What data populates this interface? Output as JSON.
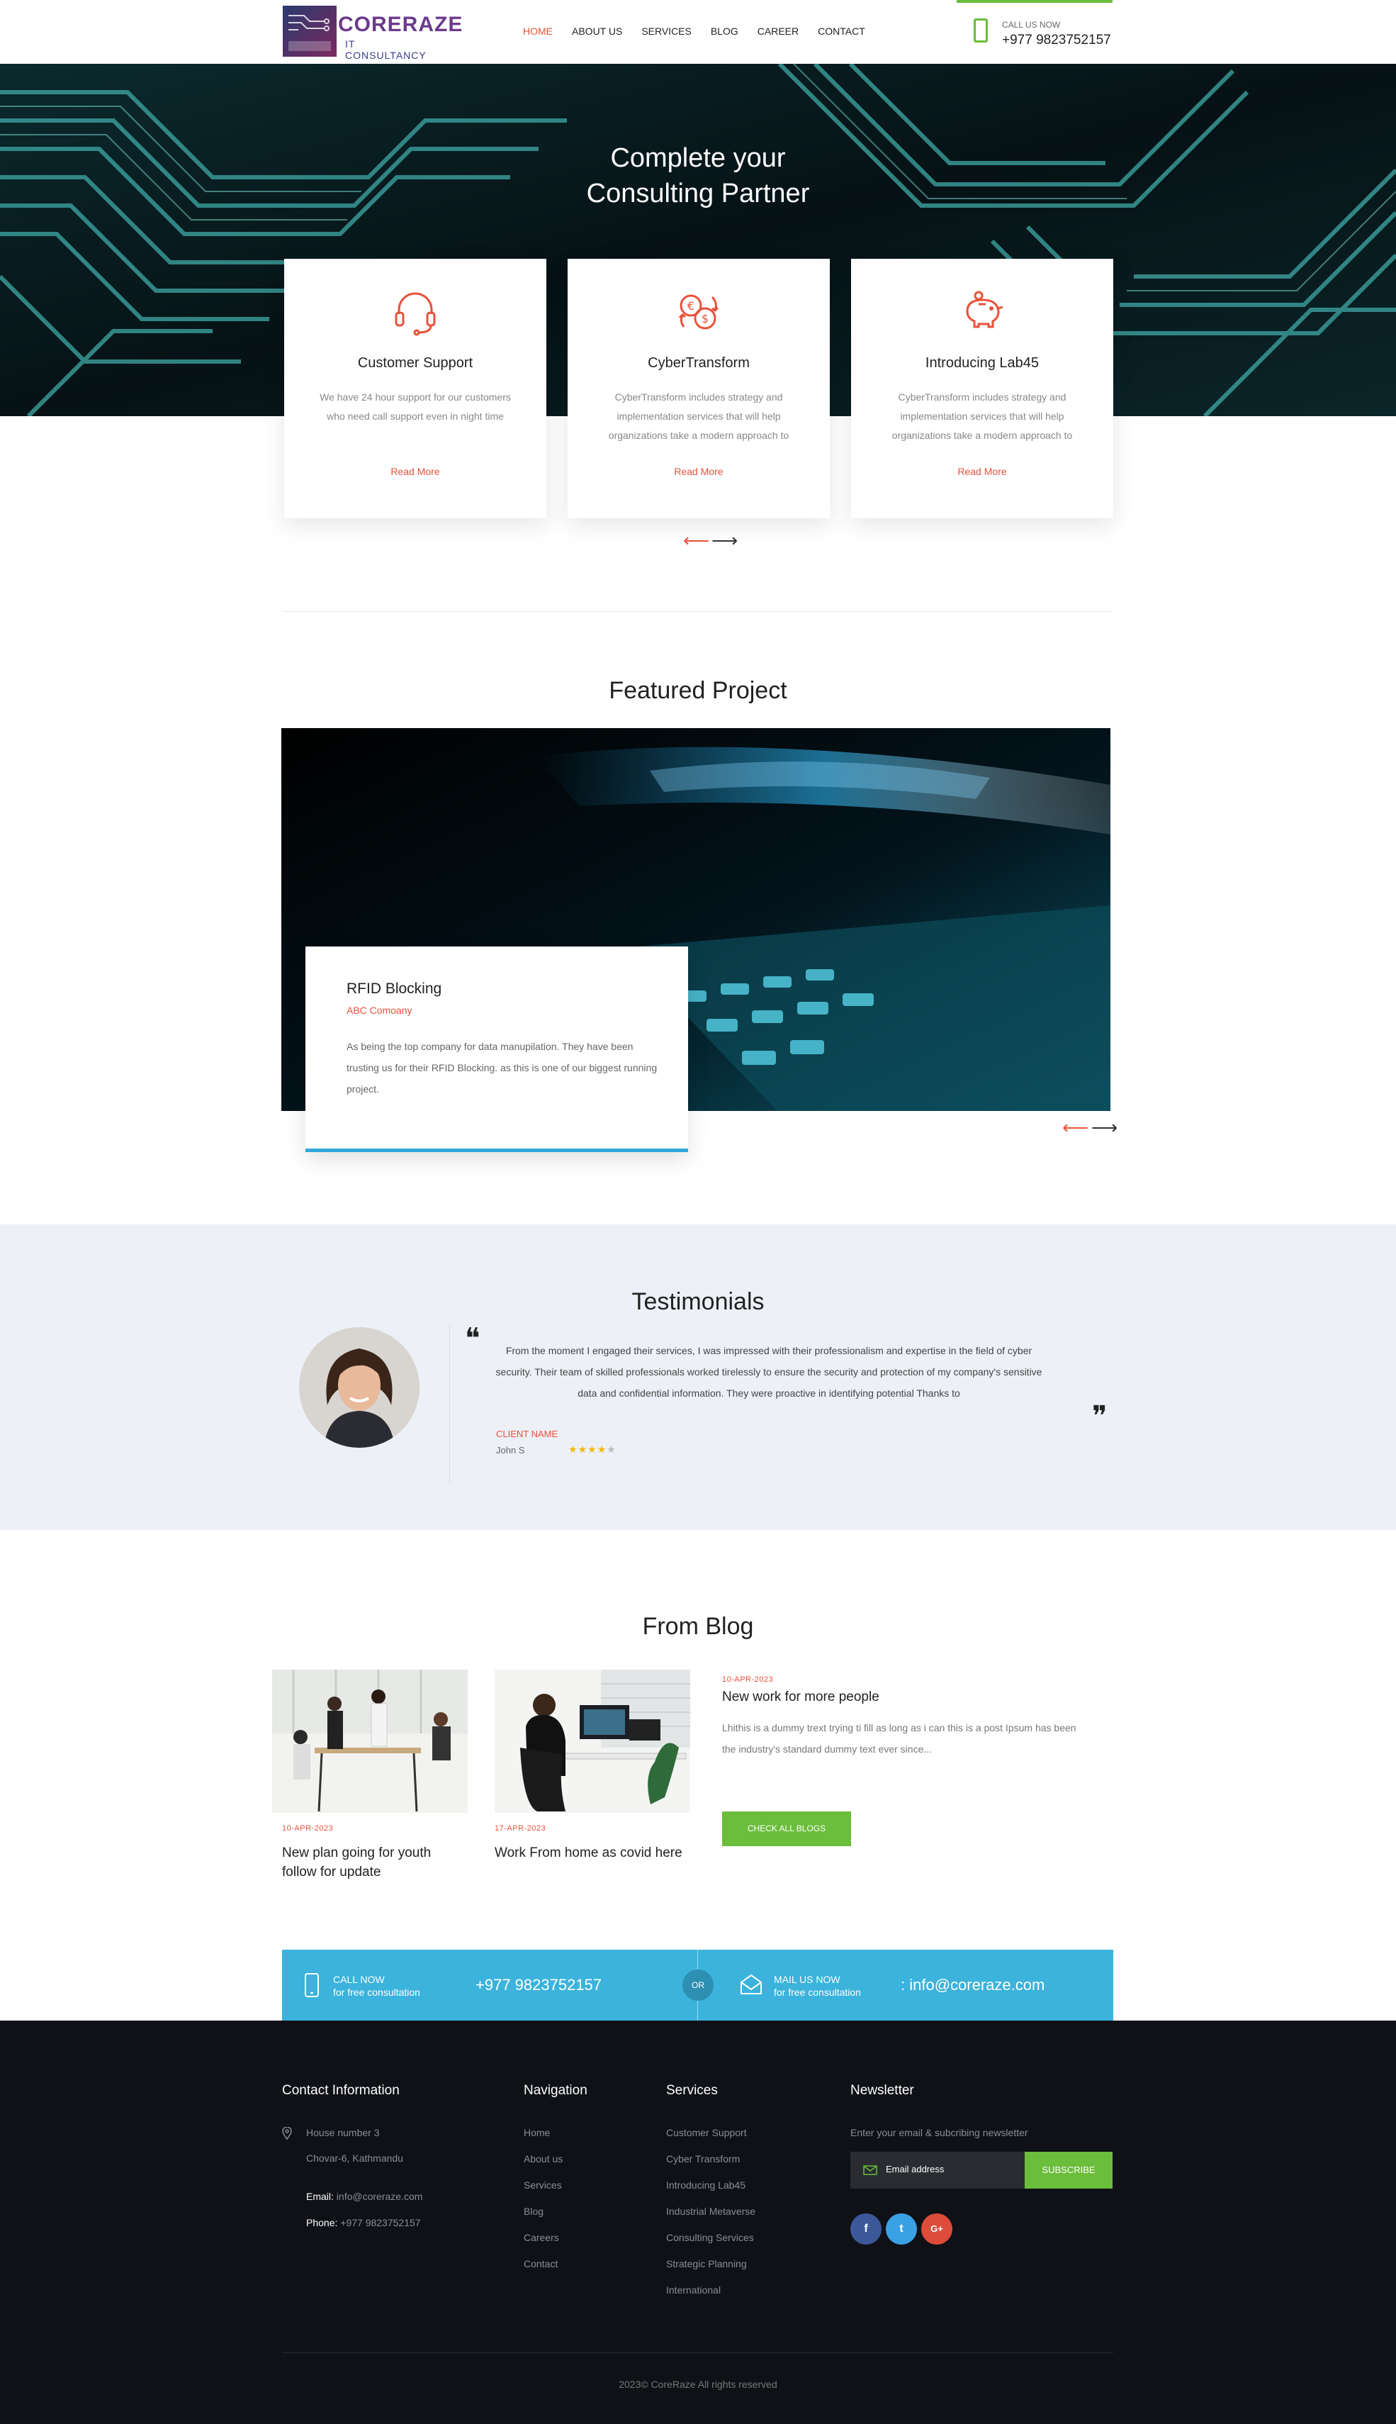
{
  "brand": {
    "logo_main": "CORERAZE",
    "logo_sub": "IT CONSULTANCY",
    "accent": "#e8523b",
    "green": "#6bbd3c",
    "blue": "#3bb3dc"
  },
  "nav": {
    "items": [
      "HOME",
      "ABOUT US",
      "SERVICES",
      "BLOG",
      "CAREER",
      "CONTACT"
    ],
    "active": "HOME"
  },
  "call": {
    "label": "CALL US NOW",
    "number": "+977 9823752157"
  },
  "hero": {
    "title_line1": "Complete your",
    "title_line2": "Consulting Partner"
  },
  "services": [
    {
      "icon": "headset-icon",
      "title": "Customer Support",
      "text": "We have 24 hour support for our customers who need call support even in night time",
      "link": "Read More"
    },
    {
      "icon": "currency-exchange-icon",
      "title": "CyberTransform",
      "text": "CyberTransform includes strategy and implementation services that will help organizations take a modern approach to",
      "link": "Read More"
    },
    {
      "icon": "piggy-bank-icon",
      "title": "Introducing Lab45",
      "text": "CyberTransform includes strategy and implementation services that will help organizations take a modern approach to",
      "link": "Read More"
    }
  ],
  "featured": {
    "section_title": "Featured Project",
    "project_title": "RFID Blocking",
    "company": "ABC Comoany",
    "description": "As being the top company for data manupilation. They have been trusting us for their RFID Blocking. as this is one of our biggest running project."
  },
  "testimonials": {
    "section_title": "Testimonials",
    "quote": "From the moment I engaged their services, I was impressed with their professionalism and expertise in the field of cyber security. Their team of skilled professionals worked tirelessly to ensure the security and protection of my company's sensitive data and confidential information. They were proactive in identifying potential  Thanks to",
    "client_label": "CLIENT NAME",
    "client_name": "John S",
    "rating": 4,
    "rating_max": 5
  },
  "blog": {
    "section_title": "From Blog",
    "posts": [
      {
        "date": "10-APR-2023",
        "title": "New plan going for youth follow for update"
      },
      {
        "date": "17-APR-2023",
        "title": "Work From home as covid here"
      },
      {
        "date": "10-APR-2023",
        "title": "New work for more people",
        "excerpt": "Lhithis is a dummy trext trying ti fill as long as i can this is a post Ipsum has been the industry's standard dummy text ever since..."
      }
    ],
    "button": "CHECK ALL BLOGS"
  },
  "cta": {
    "call_label": "CALL NOW",
    "call_sub": "for free consultation",
    "call_number": "+977 9823752157",
    "or": "OR",
    "mail_label": "MAIL US NOW",
    "mail_sub": "for free consultation",
    "mail_value": ": info@coreraze.com"
  },
  "footer": {
    "contact": {
      "heading": "Contact Information",
      "address1": "House number 3",
      "address2": "Chovar-6, Kathmandu",
      "email_label": "Email:",
      "email": "info@coreraze.com",
      "phone_label": "Phone:",
      "phone": "+977 9823752157"
    },
    "navigation": {
      "heading": "Navigation",
      "links": [
        "Home",
        "About us",
        "Services",
        "Blog",
        "Careers",
        "Contact"
      ]
    },
    "services": {
      "heading": "Services",
      "links": [
        "Customer Support",
        "Cyber Transform",
        "Introducing Lab45",
        "Industrial Metaverse",
        "Consulting Services",
        "Strategic Planning",
        "International"
      ]
    },
    "newsletter": {
      "heading": "Newsletter",
      "text": "Enter your email & subcribing newsletter",
      "placeholder": "Email address",
      "button": "SUBSCRIBE"
    },
    "social": [
      "f",
      "t",
      "G+"
    ],
    "copyright": "2023©  CoreRaze  All rights reserved"
  }
}
